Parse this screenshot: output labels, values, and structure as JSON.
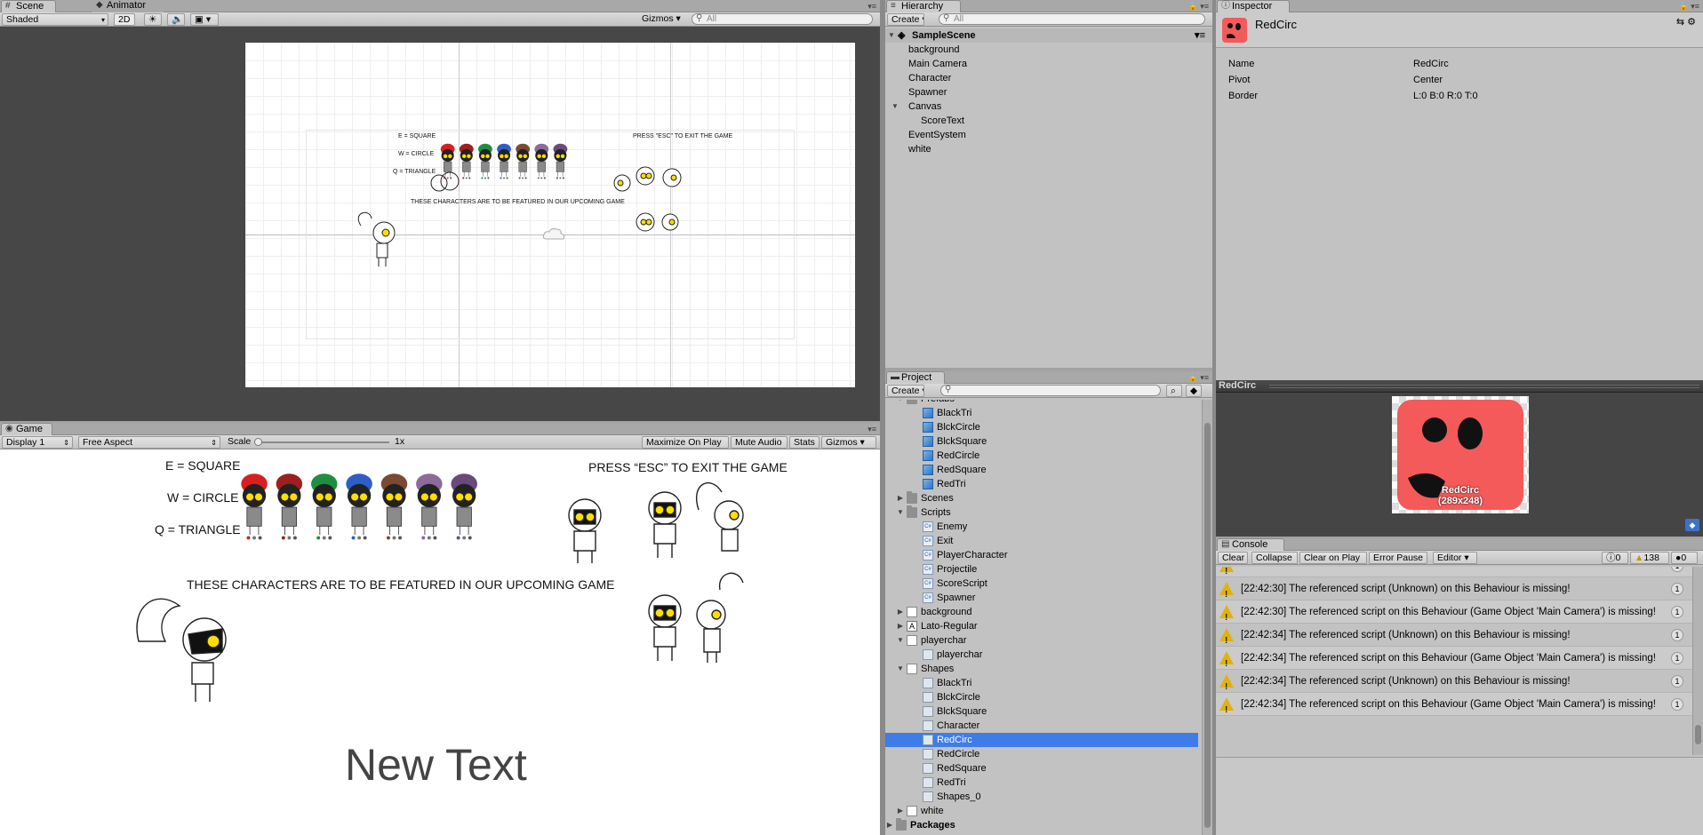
{
  "scene": {
    "tabs": [
      {
        "label": "Scene",
        "icon": "hash-icon"
      },
      {
        "label": "Animator",
        "icon": "animator-icon"
      }
    ],
    "toolbar": {
      "shading": "Shaded",
      "mode2d": "2D",
      "gizmos": "Gizmos",
      "search_placeholder": "All"
    }
  },
  "game": {
    "tab": "Game",
    "toolbar": {
      "display": "Display 1",
      "aspect": "Free Aspect",
      "scale_label": "Scale",
      "scale_value": "1x",
      "maximize": "Maximize On Play",
      "mute": "Mute Audio",
      "stats": "Stats",
      "gizmos": "Gizmos"
    },
    "content": {
      "legend": [
        "E = SQUARE",
        "W = CIRCLE",
        "Q = TRIANGLE"
      ],
      "exit": "PRESS “ESC” TO EXIT THE GAME",
      "featured": "THESE CHARACTERS ARE TO BE FEATURED IN OUR UPCOMING GAME",
      "score_text": "New Text",
      "hair_colors": [
        "#d81f1f",
        "#9e1f1f",
        "#1f8f3f",
        "#2e5fc8",
        "#7b4a33",
        "#8c6a9c",
        "#6a4a7a"
      ]
    },
    "scene_exit": "PRESS \"ESC\" TO EXIT THE GAME"
  },
  "hierarchy": {
    "tab": "Hierarchy",
    "create": "Create",
    "search_placeholder": "All",
    "scene": "SampleScene",
    "items": [
      {
        "label": "background",
        "depth": 1
      },
      {
        "label": "Main Camera",
        "depth": 1
      },
      {
        "label": "Character",
        "depth": 1
      },
      {
        "label": "Spawner",
        "depth": 1
      },
      {
        "label": "Canvas",
        "depth": 1,
        "expanded": true
      },
      {
        "label": "ScoreText",
        "depth": 2
      },
      {
        "label": "EventSystem",
        "depth": 1
      },
      {
        "label": "white",
        "depth": 1
      }
    ]
  },
  "project": {
    "tab": "Project",
    "create": "Create",
    "items": [
      {
        "label": "Prefabs",
        "depth": 1,
        "icon": "folder",
        "arrow": "open"
      },
      {
        "label": "BlackTri",
        "depth": 2,
        "icon": "prefab"
      },
      {
        "label": "BlckCircle",
        "depth": 2,
        "icon": "prefab"
      },
      {
        "label": "BlckSquare",
        "depth": 2,
        "icon": "prefab"
      },
      {
        "label": "RedCircle",
        "depth": 2,
        "icon": "prefab"
      },
      {
        "label": "RedSquare",
        "depth": 2,
        "icon": "prefab"
      },
      {
        "label": "RedTri",
        "depth": 2,
        "icon": "prefab"
      },
      {
        "label": "Scenes",
        "depth": 1,
        "icon": "folder",
        "arrow": "closed"
      },
      {
        "label": "Scripts",
        "depth": 1,
        "icon": "folder",
        "arrow": "open"
      },
      {
        "label": "Enemy",
        "depth": 2,
        "icon": "cs"
      },
      {
        "label": "Exit",
        "depth": 2,
        "icon": "cs"
      },
      {
        "label": "PlayerCharacter",
        "depth": 2,
        "icon": "cs"
      },
      {
        "label": "Projectile",
        "depth": 2,
        "icon": "cs"
      },
      {
        "label": "ScoreScript",
        "depth": 2,
        "icon": "cs"
      },
      {
        "label": "Spawner",
        "depth": 2,
        "icon": "cs"
      },
      {
        "label": "background",
        "depth": 1,
        "icon": "tex",
        "arrow": "closed"
      },
      {
        "label": "Lato-Regular",
        "depth": 1,
        "icon": "font",
        "arrow": "closed"
      },
      {
        "label": "playerchar",
        "depth": 1,
        "icon": "tex",
        "arrow": "open"
      },
      {
        "label": "playerchar",
        "depth": 2,
        "icon": "sprite"
      },
      {
        "label": "Shapes",
        "depth": 1,
        "icon": "tex",
        "arrow": "open"
      },
      {
        "label": "BlackTri",
        "depth": 2,
        "icon": "sprite"
      },
      {
        "label": "BlckCircle",
        "depth": 2,
        "icon": "sprite"
      },
      {
        "label": "BlckSquare",
        "depth": 2,
        "icon": "sprite"
      },
      {
        "label": "Character",
        "depth": 2,
        "icon": "sprite"
      },
      {
        "label": "RedCirc",
        "depth": 2,
        "icon": "sprite",
        "selected": true
      },
      {
        "label": "RedCircle",
        "depth": 2,
        "icon": "sprite"
      },
      {
        "label": "RedSquare",
        "depth": 2,
        "icon": "sprite"
      },
      {
        "label": "RedTri",
        "depth": 2,
        "icon": "sprite"
      },
      {
        "label": "Shapes_0",
        "depth": 2,
        "icon": "sprite"
      },
      {
        "label": "white",
        "depth": 1,
        "icon": "tex",
        "arrow": "closed"
      },
      {
        "label": "Packages",
        "depth": 0,
        "icon": "folder",
        "arrow": "closed",
        "bold": true
      }
    ]
  },
  "inspector": {
    "tab": "Inspector",
    "title": "RedCirc",
    "props": [
      {
        "k": "Name",
        "v": "RedCirc"
      },
      {
        "k": "Pivot",
        "v": "Center"
      },
      {
        "k": "Border",
        "v": "L:0 B:0 R:0 T:0"
      }
    ],
    "preview_header": "RedCirc",
    "preview_name": "RedCirc",
    "preview_size": "(289x248)",
    "accent": "#f45a5a"
  },
  "console": {
    "tab": "Console",
    "buttons": {
      "clear": "Clear",
      "collapse": "Collapse",
      "clear_on_play": "Clear on Play",
      "error_pause": "Error Pause",
      "editor": "Editor"
    },
    "counts": {
      "info": "0",
      "warn": "138",
      "error": "0"
    },
    "messages": [
      {
        "text": "[22:42:30] The referenced script (Unknown) on this Behaviour is missing!",
        "count": "1"
      },
      {
        "text": "[22:42:30] The referenced script on this Behaviour (Game Object 'Main Camera') is missing!",
        "count": "1"
      },
      {
        "text": "[22:42:34] The referenced script (Unknown) on this Behaviour is missing!",
        "count": "1"
      },
      {
        "text": "[22:42:34] The referenced script on this Behaviour (Game Object 'Main Camera') is missing!",
        "count": "1"
      },
      {
        "text": "[22:42:34] The referenced script (Unknown) on this Behaviour is missing!",
        "count": "1"
      },
      {
        "text": "[22:42:34] The referenced script on this Behaviour (Game Object 'Main Camera') is missing!",
        "count": "1"
      }
    ]
  }
}
